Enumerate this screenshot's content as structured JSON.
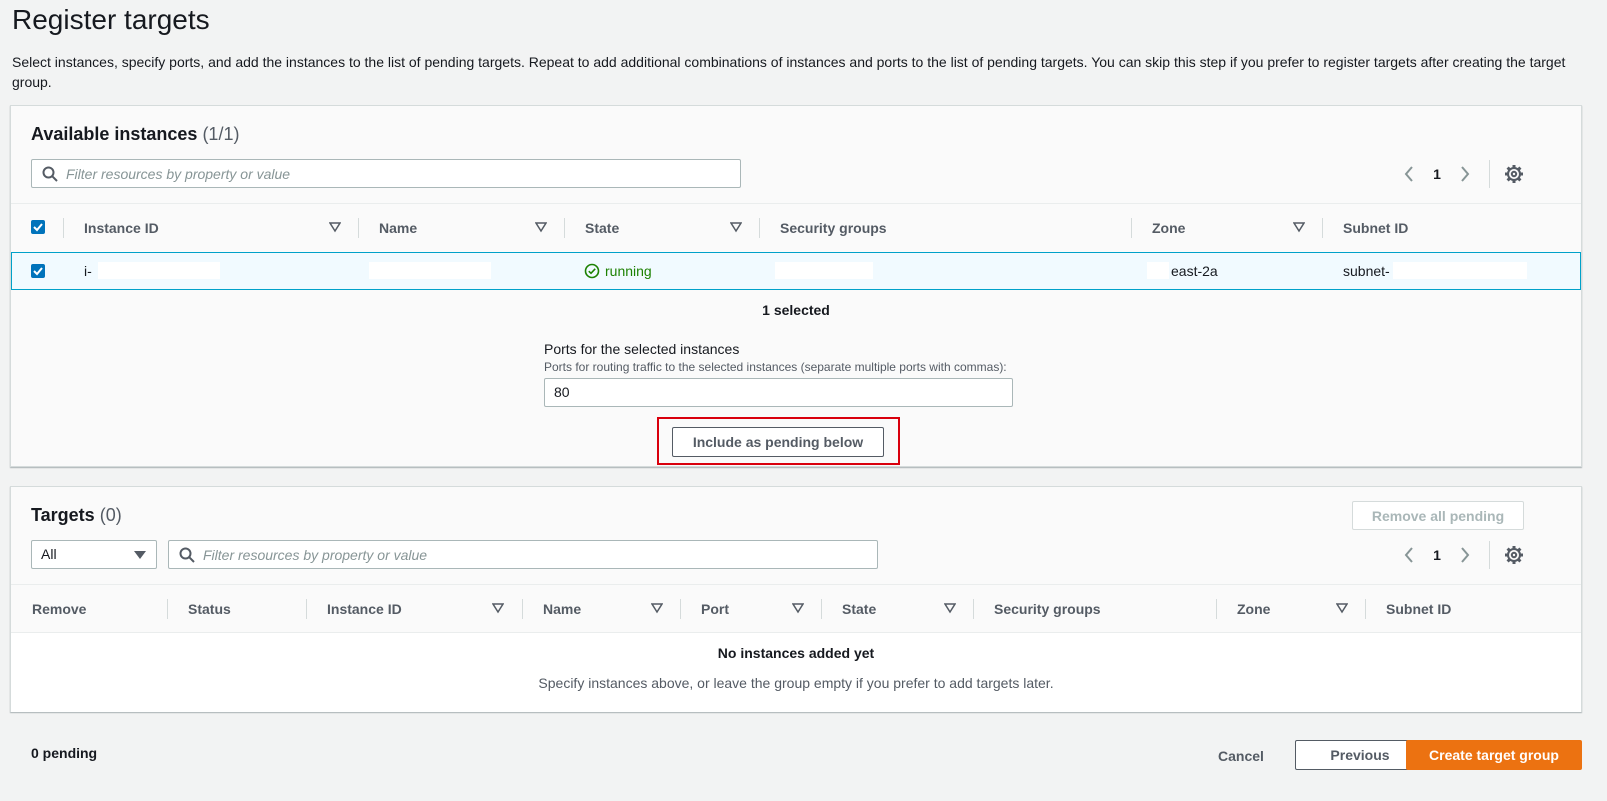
{
  "page": {
    "title": "Register targets",
    "description": "Select instances, specify ports, and add the instances to the list of pending targets. Repeat to add additional combinations of instances and ports to the list of pending targets. You can skip this step if you prefer to register targets after creating the target group."
  },
  "available": {
    "title": "Available instances",
    "count": "(1/1)",
    "filter_placeholder": "Filter resources by property or value",
    "page_number": "1",
    "columns": {
      "instance_id": "Instance ID",
      "name": "Name",
      "state": "State",
      "security_groups": "Security groups",
      "zone": "Zone",
      "subnet_id": "Subnet ID"
    },
    "rows": [
      {
        "instance_id": "i-",
        "state": "running",
        "zone": "east-2a",
        "subnet_id": "subnet-"
      }
    ],
    "selected_text": "1 selected",
    "ports_label": "Ports for the selected instances",
    "ports_help": "Ports for routing traffic to the selected instances (separate multiple ports with commas):",
    "ports_value": "80",
    "include_button": "Include as pending below"
  },
  "targets": {
    "title": "Targets",
    "count": "(0)",
    "remove_all_button": "Remove all pending",
    "filter_select": "All",
    "filter_placeholder": "Filter resources by property or value",
    "page_number": "1",
    "columns": {
      "remove": "Remove",
      "status": "Status",
      "instance_id": "Instance ID",
      "name": "Name",
      "port": "Port",
      "state": "State",
      "security_groups": "Security groups",
      "zone": "Zone",
      "subnet_id": "Subnet ID"
    },
    "empty_title": "No instances added yet",
    "empty_desc": "Specify instances above, or leave the group empty if you prefer to add targets later."
  },
  "footer": {
    "pending": "0 pending",
    "cancel": "Cancel",
    "previous": "Previous",
    "create": "Create target group"
  },
  "colors": {
    "primary": "#ec7211",
    "checkbox": "#0073bb",
    "running": "#1d8102",
    "highlight": "#d9000d"
  }
}
